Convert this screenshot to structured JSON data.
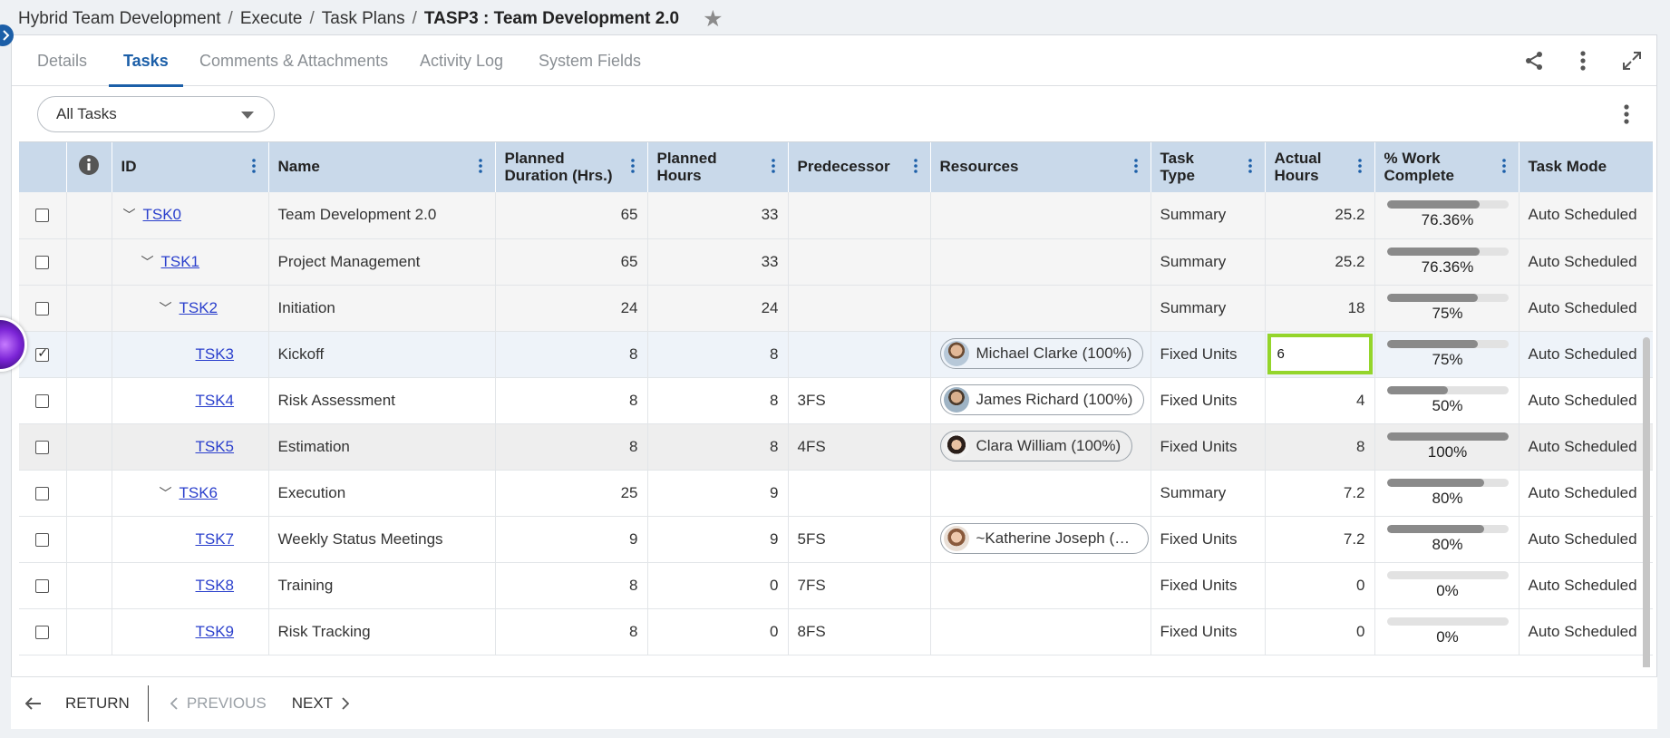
{
  "breadcrumb": {
    "items": [
      "Hybrid Team Development",
      "Execute",
      "Task Plans"
    ],
    "current": "TASP3 : Team Development 2.0"
  },
  "tabs": [
    {
      "label": "Details",
      "active": false
    },
    {
      "label": "Tasks",
      "active": true
    },
    {
      "label": "Comments & Attachments",
      "active": false
    },
    {
      "label": "Activity Log",
      "active": false
    },
    {
      "label": "System Fields",
      "active": false
    }
  ],
  "filter": {
    "selected": "All Tasks"
  },
  "columns": {
    "id": "ID",
    "name": "Name",
    "planned_duration": "Planned Duration (Hrs.)",
    "planned_hours": "Planned Hours",
    "predecessor": "Predecessor",
    "resources": "Resources",
    "task_type": "Task Type",
    "actual_hours": "Actual Hours",
    "work_complete": "% Work Complete",
    "task_mode": "Task Mode"
  },
  "rows": [
    {
      "id": "TSK0",
      "name": "Team Development 2.0",
      "planned_duration": "65",
      "planned_hours": "33",
      "predecessor": "",
      "resource": "",
      "task_type": "Summary",
      "actual_hours": "25.2",
      "work_complete": "76.36%",
      "progress": 76.36,
      "task_mode": "Auto Scheduled",
      "checked": false
    },
    {
      "id": "TSK1",
      "name": "Project Management",
      "planned_duration": "65",
      "planned_hours": "33",
      "predecessor": "",
      "resource": "",
      "task_type": "Summary",
      "actual_hours": "25.2",
      "work_complete": "76.36%",
      "progress": 76.36,
      "task_mode": "Auto Scheduled",
      "checked": false
    },
    {
      "id": "TSK2",
      "name": "Initiation",
      "planned_duration": "24",
      "planned_hours": "24",
      "predecessor": "",
      "resource": "",
      "task_type": "Summary",
      "actual_hours": "18",
      "work_complete": "75%",
      "progress": 75,
      "task_mode": "Auto Scheduled",
      "checked": false
    },
    {
      "id": "TSK3",
      "name": "Kickoff",
      "planned_duration": "8",
      "planned_hours": "8",
      "predecessor": "",
      "resource": "Michael Clarke (100%)",
      "task_type": "Fixed Units",
      "actual_hours": "6",
      "work_complete": "75%",
      "progress": 75,
      "task_mode": "Auto Scheduled",
      "checked": true
    },
    {
      "id": "TSK4",
      "name": "Risk Assessment",
      "planned_duration": "8",
      "planned_hours": "8",
      "predecessor": "3FS",
      "resource": "James Richard (100%)",
      "task_type": "Fixed Units",
      "actual_hours": "4",
      "work_complete": "50%",
      "progress": 50,
      "task_mode": "Auto Scheduled",
      "checked": false
    },
    {
      "id": "TSK5",
      "name": "Estimation",
      "planned_duration": "8",
      "planned_hours": "8",
      "predecessor": "4FS",
      "resource": "Clara William (100%)",
      "task_type": "Fixed Units",
      "actual_hours": "8",
      "work_complete": "100%",
      "progress": 100,
      "task_mode": "Auto Scheduled",
      "checked": false
    },
    {
      "id": "TSK6",
      "name": "Execution",
      "planned_duration": "25",
      "planned_hours": "9",
      "predecessor": "",
      "resource": "",
      "task_type": "Summary",
      "actual_hours": "7.2",
      "work_complete": "80%",
      "progress": 80,
      "task_mode": "Auto Scheduled",
      "checked": false
    },
    {
      "id": "TSK7",
      "name": "Weekly Status Meetings",
      "planned_duration": "9",
      "planned_hours": "9",
      "predecessor": "5FS",
      "resource": "~Katherine Joseph (1…",
      "task_type": "Fixed Units",
      "actual_hours": "7.2",
      "work_complete": "80%",
      "progress": 80,
      "task_mode": "Auto Scheduled",
      "checked": false
    },
    {
      "id": "TSK8",
      "name": "Training",
      "planned_duration": "8",
      "planned_hours": "0",
      "predecessor": "7FS",
      "resource": "",
      "task_type": "Fixed Units",
      "actual_hours": "0",
      "work_complete": "0%",
      "progress": 0,
      "task_mode": "Auto Scheduled",
      "checked": false
    },
    {
      "id": "TSK9",
      "name": "Risk Tracking",
      "planned_duration": "8",
      "planned_hours": "0",
      "predecessor": "8FS",
      "resource": "",
      "task_type": "Fixed Units",
      "actual_hours": "0",
      "work_complete": "0%",
      "progress": 0,
      "task_mode": "Auto Scheduled",
      "checked": false
    }
  ],
  "footer": {
    "return_label": "RETURN",
    "previous_label": "PREVIOUS",
    "next_label": "NEXT"
  },
  "colors": {
    "accent": "#1c5fa8",
    "header_bg": "#c9d9ea",
    "edit_highlight": "#94d52b",
    "progress_fill": "#8a8a8a"
  }
}
